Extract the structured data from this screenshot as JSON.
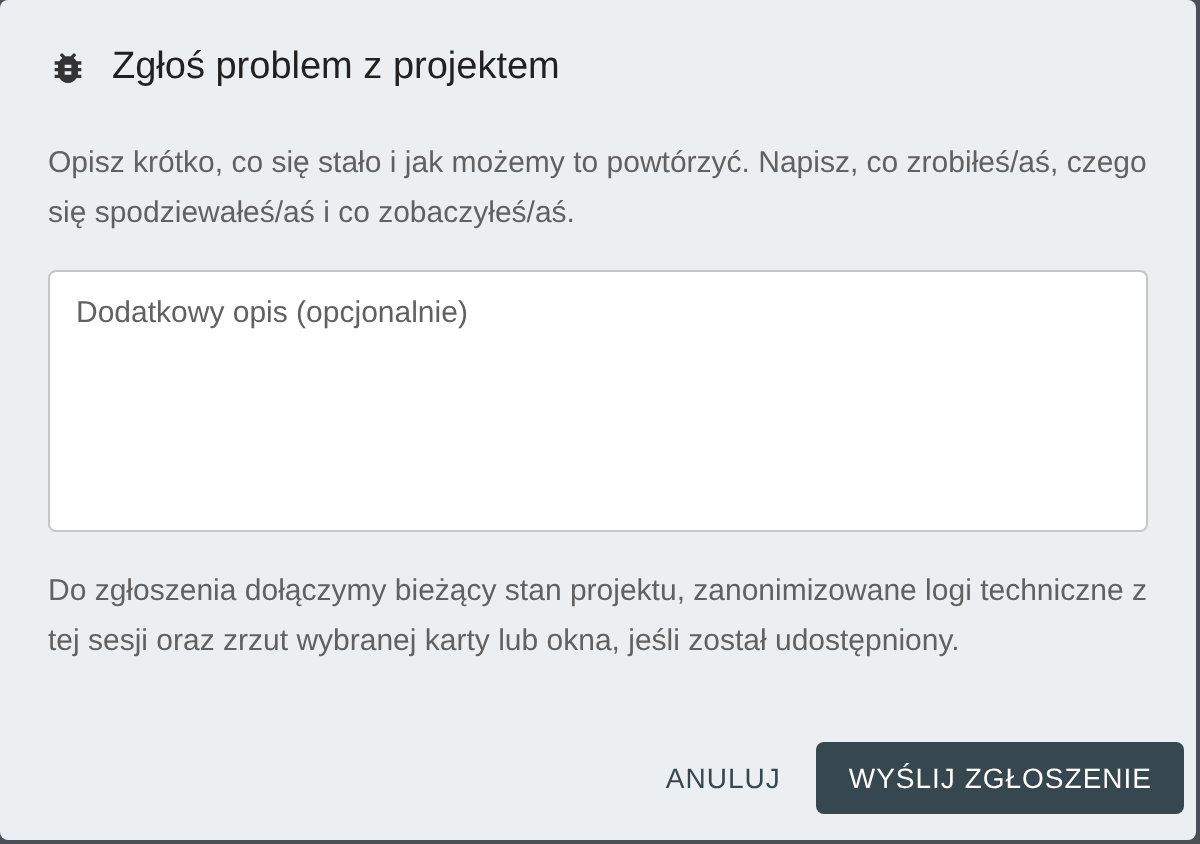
{
  "dialog": {
    "title": "Zgłoś problem z projektem",
    "intro": "Opisz krótko, co się stało i jak możemy to powtórzyć. Napisz, co zrobiłeś/aś, czego się spodziewałeś/aś i co zobaczyłeś/aś.",
    "description_field": {
      "placeholder": "Dodatkowy opis (opcjonalnie)"
    },
    "notice": "Do zgłoszenia dołączymy bieżący stan projektu, zanonimizowane logi techniczne z tej sesji oraz zrzut wybranej karty lub okna, jeśli został udostępniony.",
    "buttons": [
      {
        "label": "ANULUJ",
        "kind": "text"
      },
      {
        "label": "WYŚLIJ ZGŁOSZENIE",
        "kind": "primary"
      }
    ]
  }
}
